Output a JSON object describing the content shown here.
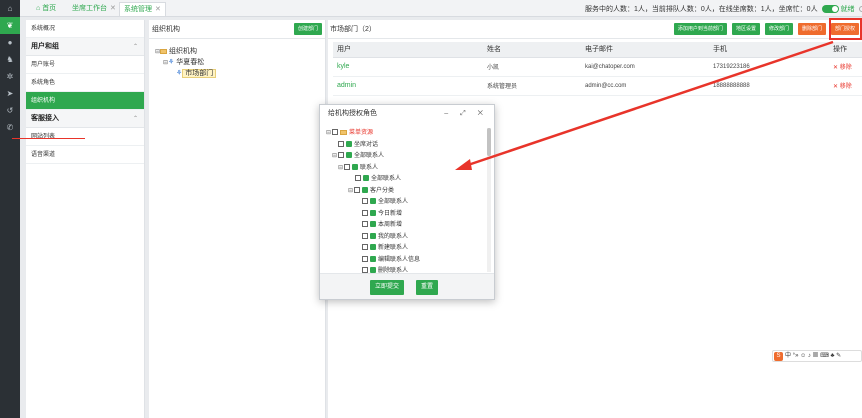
{
  "rail": {
    "icons": [
      "home-icon",
      "leaf-icon",
      "user-icon",
      "org-icon",
      "gear-icon",
      "send-icon",
      "history-icon",
      "phone-icon"
    ]
  },
  "tabs": {
    "home": "首页",
    "workbench": "坐席工作台",
    "system": "系统管理",
    "close": "✕"
  },
  "status": {
    "text": "服务中的人数：1人，当前排队人数：0人，在线坐席数：1人，坐席忙：0人",
    "toggle_label": "就绪",
    "radio_label": "示忙"
  },
  "submenu": {
    "items": [
      {
        "label": "系统概况",
        "type": "item"
      },
      {
        "label": "用户和组",
        "type": "head"
      },
      {
        "label": "用户账号",
        "type": "item"
      },
      {
        "label": "系统角色",
        "type": "item"
      },
      {
        "label": "组织机构",
        "type": "active"
      },
      {
        "label": "客服接入",
        "type": "head"
      },
      {
        "label": "网站列表",
        "type": "item"
      },
      {
        "label": "语音渠道",
        "type": "item"
      }
    ]
  },
  "org": {
    "title": "组织机构",
    "create_button": "创建部门",
    "tree": {
      "root": "组织机构",
      "company": "华夏春松",
      "dept": "市场部门"
    }
  },
  "main": {
    "title": "市场部门（2）",
    "buttons": {
      "add_user": "添加用户到当前部门",
      "region": "地区设置",
      "edit": "修改部门",
      "delete": "删除部门",
      "authorize": "部门授权"
    },
    "columns": [
      "用户",
      "姓名",
      "电子邮件",
      "手机",
      "操作"
    ],
    "rows": [
      {
        "user": "kyle",
        "name": "小凯",
        "email": "kai@chatoper.com",
        "phone": "17319223186",
        "action": "✕ 移除"
      },
      {
        "user": "admin",
        "name": "系统管理员",
        "email": "admin@cc.com",
        "phone": "18888888888",
        "action": "✕ 移除"
      }
    ]
  },
  "dialog": {
    "title": "给机构授权角色",
    "controls": "–  ⤢  ✕",
    "tree": [
      {
        "label": "菜单资源",
        "level": 0,
        "toggle": "⊟",
        "kind": "folder"
      },
      {
        "label": "坐席对话",
        "level": 1,
        "toggle": "",
        "kind": "leaf"
      },
      {
        "label": "全部联系人",
        "level": 1,
        "toggle": "⊟",
        "kind": "leaf"
      },
      {
        "label": "联系人",
        "level": 2,
        "toggle": "⊟",
        "kind": "leaf"
      },
      {
        "label": "全部联系人",
        "level": 3,
        "toggle": "",
        "kind": "leaf"
      },
      {
        "label": "客户分类",
        "level": 3,
        "toggle": "⊟",
        "kind": "leaf"
      },
      {
        "label": "全部联系人",
        "level": 4,
        "toggle": "",
        "kind": "leaf"
      },
      {
        "label": "今日新增",
        "level": 4,
        "toggle": "",
        "kind": "leaf"
      },
      {
        "label": "本周新增",
        "level": 4,
        "toggle": "",
        "kind": "leaf"
      },
      {
        "label": "我的联系人",
        "level": 4,
        "toggle": "",
        "kind": "leaf"
      },
      {
        "label": "新建联系人",
        "level": 4,
        "toggle": "",
        "kind": "leaf"
      },
      {
        "label": "编辑联系人信息",
        "level": 4,
        "toggle": "",
        "kind": "leaf"
      },
      {
        "label": "删除联系人",
        "level": 4,
        "toggle": "",
        "kind": "leaf"
      }
    ],
    "submit": "立即提交",
    "reset": "重置"
  },
  "ime": {
    "text": "中 °» ☺ ♪ ▦ ⌨ ♣ ✎"
  },
  "colors": {
    "accent": "#2fa84f",
    "danger": "#e8342a",
    "orange": "#ef6c2e",
    "rail": "#2b3035"
  }
}
